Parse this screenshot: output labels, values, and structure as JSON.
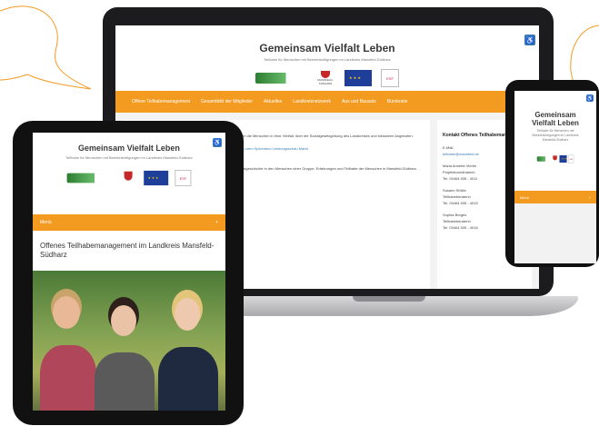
{
  "site": {
    "title": "Gemeinsam Vielfalt Leben",
    "subtitle": "Teilhabe für Menschen mit Beeinträchtigungen im Landkreis Mansfeld-Südharz",
    "colors": {
      "accent": "#f39b21",
      "link": "#3a7cb8",
      "a11y": "#3a7cb8"
    },
    "logos": [
      "green-ribbon-logo",
      "mansfeld-suedharz-crest",
      "eu-flag-logo",
      "esf-logo"
    ],
    "crest_text": "MANSFELD-SÜDHARZ"
  },
  "nav": {
    "items": [
      "Offene Teilhabemanagement",
      "Gesamtbild der Mitglieder",
      "Aktuelles",
      "Landkreisnetzwerk",
      "Aus und Bausatz",
      "Bürokratie"
    ]
  },
  "main": {
    "para1": "ihre und beeinträchtigungen gestalten im gemeinsamen Zusammenleben die Menschen in ihrer Vielfalt, über die Sozialgesetzgebung des Landkreises und inklusiven Angeboten.",
    "link": "Lorem Spicentum Leistungsschau Markt",
    "para2": "... Ansicht im Landkreis Mansfeld-Südharz eine kleine Aufgabe auf Sozialgeschichte in den Menschen einer Gruppe. Erfahrungen und Teilhabe der Menschen in Mansfeld-Südharz-Landkreis werden.",
    "strong": "Unser Wissen für Barrierefreiheit"
  },
  "sidebar": {
    "title": "Kontakt Offenes Teilhabemanagement",
    "email_label": "E-Mail",
    "email": "teilhabe@mansfeld.de",
    "contacts": [
      {
        "name": "Maria Annette Vierke",
        "role": "Projektkoordinatorin",
        "tel": "Tel. 03464 535 - 4011"
      },
      {
        "name": "Susann Stülke",
        "role": "Teilhabeberaterin",
        "tel": "Tel. 03464 535 - 4015"
      },
      {
        "name": "Sophia Borges",
        "role": "Teilhabeberaterin",
        "tel": "Tel. 03464 535 - 4016"
      }
    ]
  },
  "tablet": {
    "menu_label": "Menü",
    "menu_icon": "plus-icon",
    "article_title": "Offenes Teilhabemanagement im Landkreis Mansfeld-Südharz"
  },
  "phone": {
    "menu_label": "Menü",
    "menu_icon": "plus-icon"
  }
}
